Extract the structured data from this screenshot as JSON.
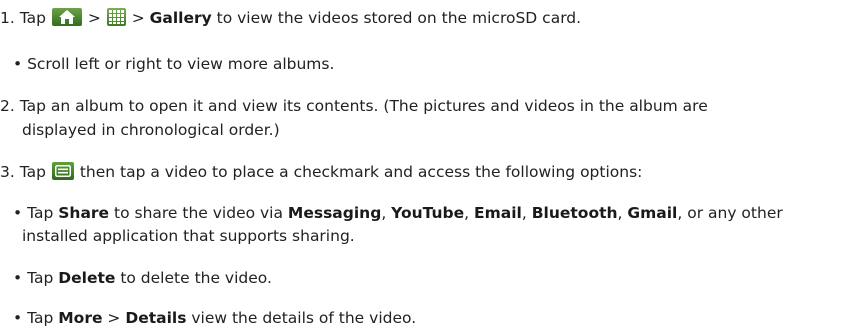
{
  "step1": {
    "num": "1. Tap",
    "sep1": ">",
    "sep2": "> ",
    "gallery": "Gallery",
    "tail": " to view the videos stored on the microSD card."
  },
  "step1_bullet": {
    "text": "• Scroll left or right to view more albums."
  },
  "step2": {
    "line1": "2. Tap an album to open it and view its contents. (The pictures and videos in the album are",
    "line2": "displayed in chronological order.)"
  },
  "step3": {
    "num": "3. Tap",
    "tail": " then tap a video to place a checkmark and access the following options:"
  },
  "share_bullet": {
    "lead": "• Tap ",
    "share": "Share",
    "t1": " to share the video via ",
    "messaging": "Messaging",
    "c1": ", ",
    "youtube": "YouTube",
    "c2": ", ",
    "email": "Email",
    "c3": ", ",
    "bluetooth": "Bluetooth",
    "c4": ", ",
    "gmail": "Gmail",
    "t2": ", or any other",
    "line2": "installed application that supports sharing."
  },
  "delete_bullet": {
    "lead": "• Tap ",
    "delete": "Delete",
    "tail": " to delete the video."
  },
  "more_bullet": {
    "lead": "• Tap ",
    "more": "More",
    "sep": " > ",
    "details": "Details",
    "tail": " view the details of the video."
  },
  "icons": {
    "home": "home-icon",
    "apps": "apps-grid-icon",
    "menu": "menu-icon"
  },
  "colors": {
    "icon_green": "#3a7a25",
    "text": "#222222"
  }
}
